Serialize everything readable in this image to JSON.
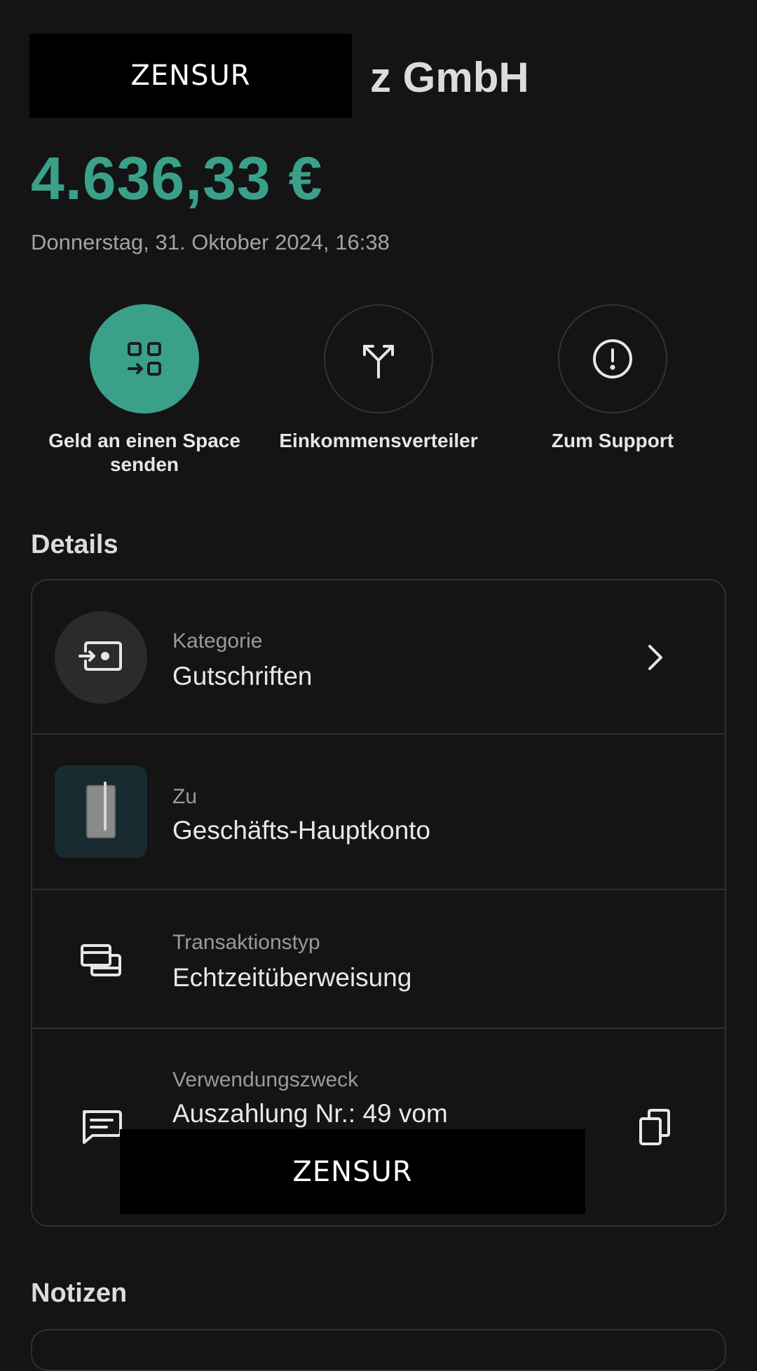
{
  "merchant": {
    "name_visible": "z GmbH",
    "censor_label": "ZENSUR"
  },
  "amount": "4.636,33 €",
  "datetime": "Donnerstag, 31. Oktober 2024, 16:38",
  "actions": [
    {
      "label": "Geld an einen Space senden",
      "icon": "space-transfer-icon",
      "primary": true
    },
    {
      "label": "Einkommensverteiler",
      "icon": "split-arrows-icon",
      "primary": false
    },
    {
      "label": "Zum Support",
      "icon": "alert-circle-icon",
      "primary": false
    }
  ],
  "details": {
    "title": "Details",
    "rows": [
      {
        "label": "Kategorie",
        "value": "Gutschriften",
        "icon": "income-icon"
      },
      {
        "label": "Zu",
        "value": "Geschäfts-Hauptkonto",
        "icon": "account-card-icon"
      },
      {
        "label": "Transaktionstyp",
        "value": "Echtzeitüberweisung",
        "icon": "transfer-type-icon"
      },
      {
        "label": "Verwendungszweck",
        "value": "Auszahlung Nr.: 49 vom",
        "icon": "message-icon",
        "censor_label": "ZENSUR"
      }
    ]
  },
  "notes": {
    "title": "Notizen"
  },
  "colors": {
    "background": "#141414",
    "accent": "#3aa08a",
    "border": "#2f2f2f"
  }
}
